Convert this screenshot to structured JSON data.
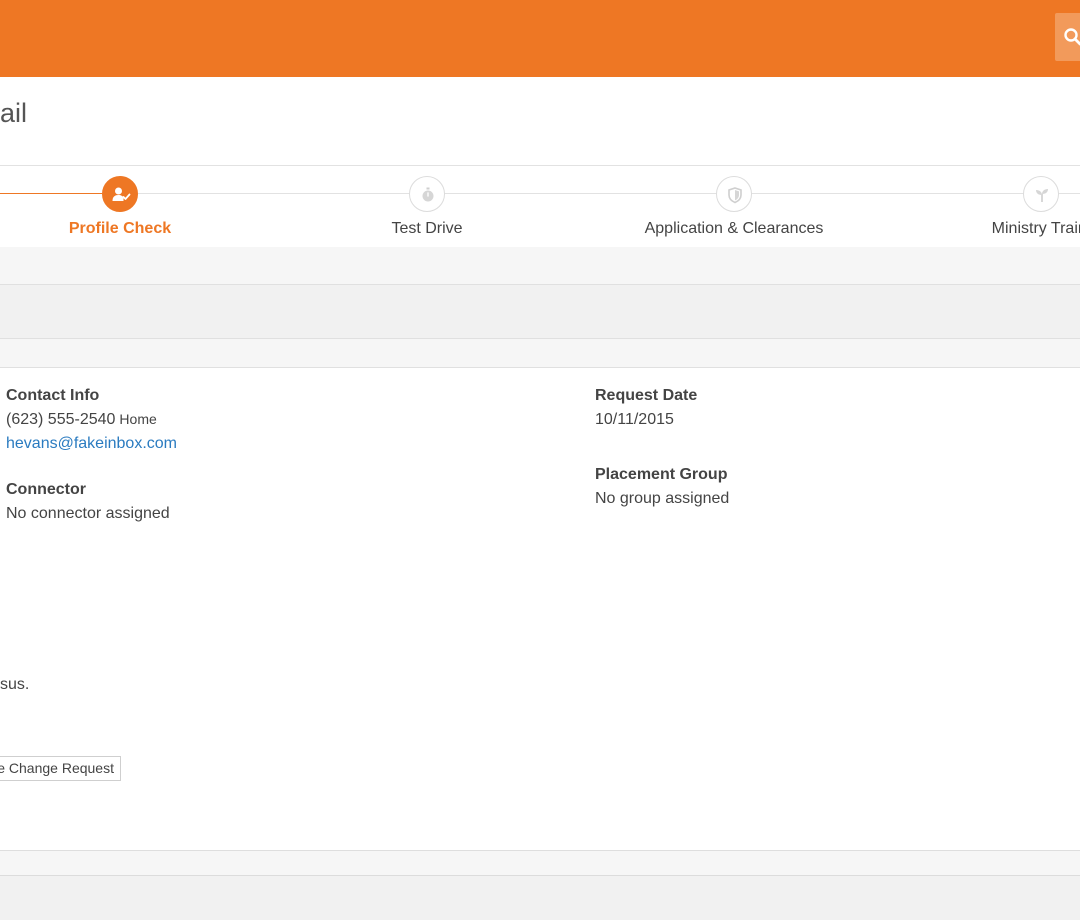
{
  "colors": {
    "brand": "#ee7724",
    "link": "#2a7bc0"
  },
  "header": {
    "search_icon": "search-icon"
  },
  "page": {
    "title": "ail"
  },
  "stepper": {
    "steps": [
      {
        "label": "Profile Check",
        "icon": "user-check-icon",
        "active": true
      },
      {
        "label": "Test Drive",
        "icon": "stopwatch-icon",
        "active": false
      },
      {
        "label": "Application & Clearances",
        "icon": "shield-icon",
        "active": false
      },
      {
        "label": "Ministry Traini",
        "icon": "sprout-icon",
        "active": false
      }
    ]
  },
  "details": {
    "contact_info": {
      "label": "Contact Info",
      "phone": "(623) 555-2540",
      "phone_type": "Home",
      "email": "hevans@fakeinbox.com"
    },
    "connector": {
      "label": "Connector",
      "value": "No connector assigned"
    },
    "request_date": {
      "label": "Request Date",
      "value": "10/11/2015"
    },
    "placement_group": {
      "label": "Placement Group",
      "value": "No group assigned"
    }
  },
  "consensus_text": "sus.",
  "change_request_button": "e Change Request"
}
